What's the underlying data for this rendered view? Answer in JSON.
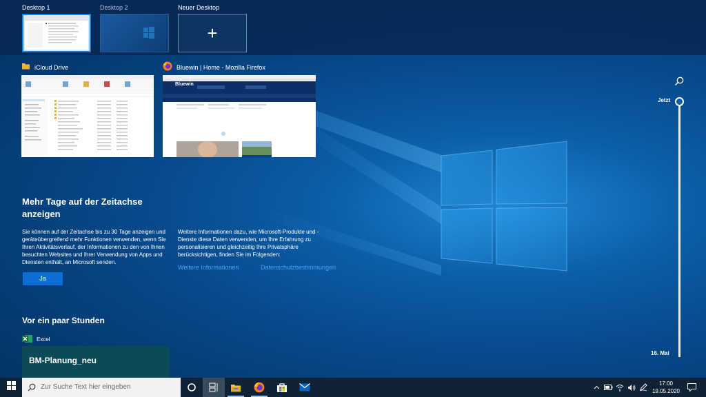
{
  "desktops": [
    {
      "label": "Desktop 1",
      "active": true
    },
    {
      "label": "Desktop 2",
      "active": false
    },
    {
      "label": "Neuer Desktop",
      "symbol": "+"
    }
  ],
  "windows": [
    {
      "title": "iCloud Drive",
      "icon": "folder-icon"
    },
    {
      "title": "Bluewin | Home - Mozilla Firefox",
      "icon": "firefox-icon",
      "site_logo": "Bluewin"
    }
  ],
  "timeline": {
    "top_label": "Jetzt",
    "bottom_label": "16. Mai"
  },
  "promo": {
    "title": "Mehr Tage auf der Zeitachse anzeigen",
    "text_left": "Sie können auf der Zeitachse bis zu 30 Tage anzeigen und geräteübergreifend mehr Funktionen verwenden, wenn Sie Ihren Aktivitätsverlauf, der Informationen zu den von Ihnen besuchten Websites und Ihrer Verwendung von Apps und Diensten enthält, an Microsoft senden.",
    "text_right": "Weitere Informationen dazu, wie Microsoft-Produkte und -Dienste diese Daten verwenden, um Ihre Erfahrung zu personalisieren und gleichzeitig Ihre Privatsphäre berücksichtigen, finden Sie im Folgenden:",
    "yes_button": "Ja",
    "link_more": "Weitere Informationen",
    "link_privacy": "Datenschutzbestimmungen"
  },
  "section": {
    "heading": "Vor ein paar Stunden",
    "app_label": "Excel",
    "card_title": "BM-Planung_neu"
  },
  "taskbar": {
    "search_placeholder": "Zur Suche Text hier eingeben",
    "pinned": [
      "cortana-icon",
      "task-view-icon",
      "file-explorer-icon",
      "firefox-icon",
      "store-icon",
      "mail-icon"
    ],
    "tray_icons": [
      "chevron-up-icon",
      "battery-icon",
      "wifi-icon",
      "volume-icon",
      "pen-icon",
      "notification-icon"
    ],
    "time": "17:00",
    "date": "19.05.2020"
  },
  "colors": {
    "accent": "#0b6fd6",
    "link": "#3fa3ff",
    "excel_green": "#1d6f42",
    "card_bg": "#0b4a56"
  }
}
